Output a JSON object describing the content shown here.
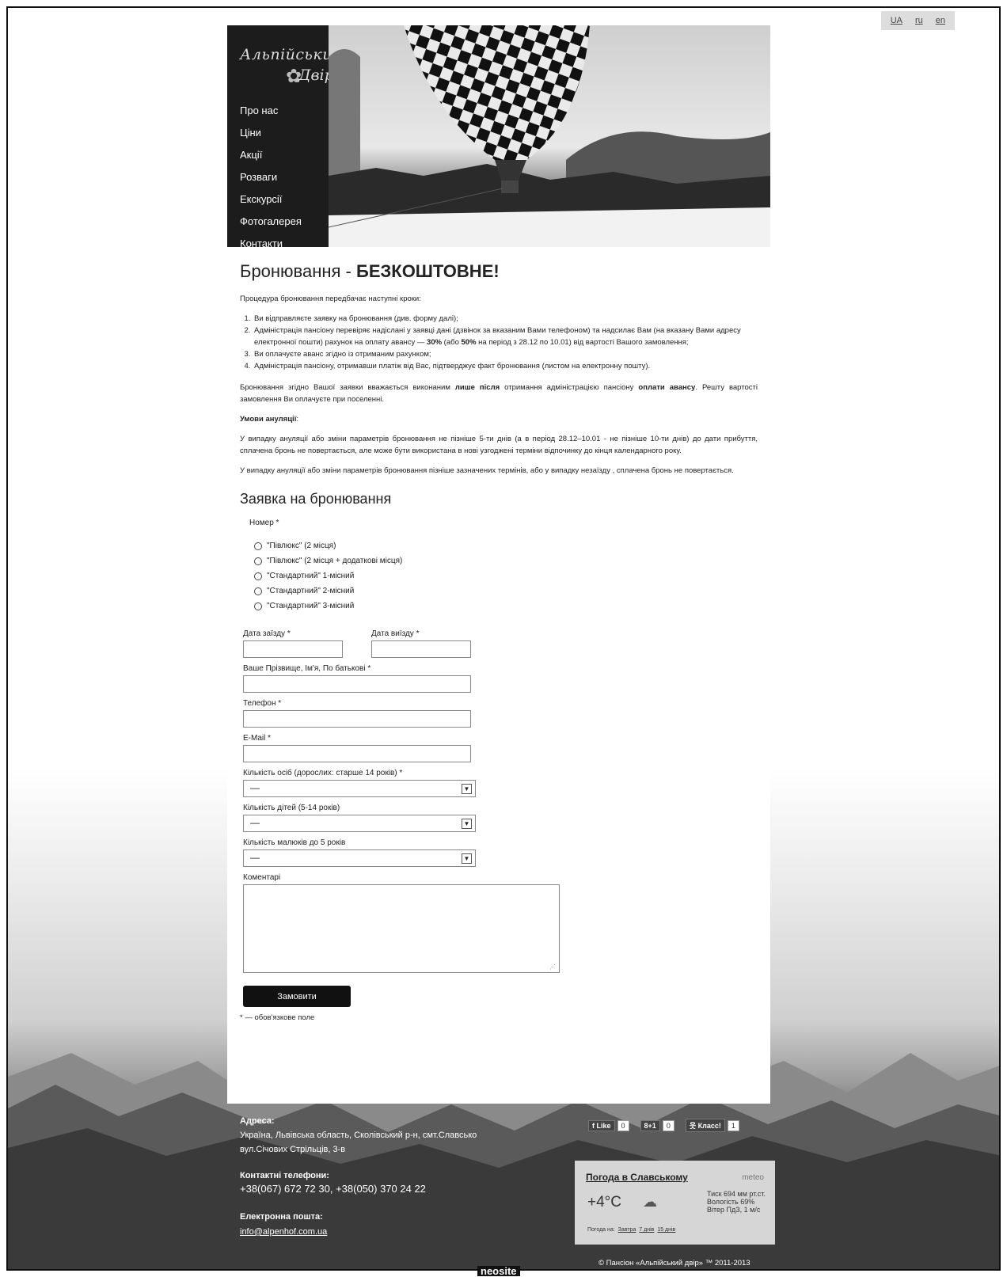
{
  "lang": [
    "UA",
    "ru",
    "en"
  ],
  "logo": {
    "line1": "Альпійський",
    "line2": "Двір",
    "tm": "™"
  },
  "nav": [
    "Про нас",
    "Ціни",
    "Акції",
    "Розваги",
    "Екскурсії",
    "Фотогалерея",
    "Контакти"
  ],
  "heading": {
    "main": "Бронювання - ",
    "bold": "БЕЗКОШТОВНЕ!"
  },
  "intro": "Процедура бронювання передбачає наступні кроки:",
  "steps": {
    "s1": "Ви відправляєте заявку на бронювання (див. форму далі);",
    "s2a": "Адміністрація пансіону перевіряє надіслані у заявці дані (дзвінок за вказаним Вами телефоном) та надсилає Вам (на вказану Вами адресу електронної пошти) рахунок на оплату авансу — ",
    "s2b1": "30%",
    "s2c": " (або ",
    "s2b2": "50%",
    "s2d": " на період з 28.12 по 10.01) від вартості Вашого замовлення;",
    "s3": "Ви оплачуєте аванс згідно із отриманим рахунком;",
    "s4": "Адміністрація пансіону, отримавши платіж від Вас, підтверджує факт бронювання (листом на електронну пошту)."
  },
  "para1": {
    "a": "Бронювання згідно Вашої заявки вважається виконаним ",
    "b": "лише після",
    "c": " отримання адміністрацією пансіону ",
    "d": "оплати авансу",
    "e": ". Решту вартості замовлення Ви оплачуєте при поселенні."
  },
  "cancel_title": "Умови ануляції",
  "cancel_colon": ":",
  "cancel_p1": "У випадку ануляції або зміни параметрів бронювання не пізніше 5-ти днів (а в період 28.12–10.01 - не пізніше 10-ти днів) до дати прибуття, сплачена бронь не повертається, але може бути використана в нові узгоджені терміни відпочинку до кінця календарного року.",
  "cancel_p2": "У випадку ануляції або зміни параметрів бронювання пізніше зазначених термінів, або у випадку незаїзду , сплачена бронь не повертається.",
  "form": {
    "title": "Заявка на бронювання",
    "room_label": "Номер *",
    "rooms": [
      "\"Півлюкс\" (2 місця)",
      "\"Півлюкс\" (2 місця + додаткові місця)",
      "\"Стандартний\" 1-місний",
      "\"Стандартний\" 2-місний",
      "\"Стандартний\" 3-місний"
    ],
    "checkin": "Дата заїзду *",
    "checkout": "Дата виїзду *",
    "name": "Ваше Прізвище, Ім'я, По батькові *",
    "phone": "Телефон *",
    "email": "E-Mail *",
    "adults": "Кількість осіб (дорослих: старше 14 років) *",
    "adults_value": "—",
    "children": "Кількість дітей (5-14 років)",
    "children_value": "—",
    "infants": "Кількість малюків до 5 років",
    "infants_value": "—",
    "comments": "Коментарі",
    "submit": "Замовити",
    "required_note": "* — обов'язкове поле"
  },
  "footer": {
    "address_title": "Адреса:",
    "address_line1": "Україна, Львівська область, Сколівський р-н, смт.Славсько",
    "address_line2": "вул.Січових Стрільців, 3-в",
    "phones_title": "Контактні телефони:",
    "phones": "+38(067) 672 72 30, +38(050) 370 24 22",
    "email_title": "Електронна пошта:",
    "email": "info@alpenhof.com.ua",
    "copyright": "© Пансіон «Альпійський двір» ™ 2011-2013",
    "neosite": "neosite"
  },
  "social": {
    "fb_label": "Like",
    "fb_count": "0",
    "gplus_label": "8+1",
    "gplus_count": "0",
    "ok_label": "Класс!",
    "ok_count": "1"
  },
  "weather": {
    "title": "Погода в Славському",
    "brand": "meteo",
    "temp": "+4°C",
    "pressure": "Тиск  694 мм рт.ст.",
    "humidity": "Вологість  69%",
    "wind": "Вітер  ПдЗ,  1 м/с",
    "links_label": "Погода на:",
    "link1": "Завтра",
    "link2": "7 днів",
    "link3": "15 днів"
  },
  "colors": {
    "page_bg": "#ffffff",
    "header_dark": "#1c1c1c",
    "button": "#111111"
  }
}
